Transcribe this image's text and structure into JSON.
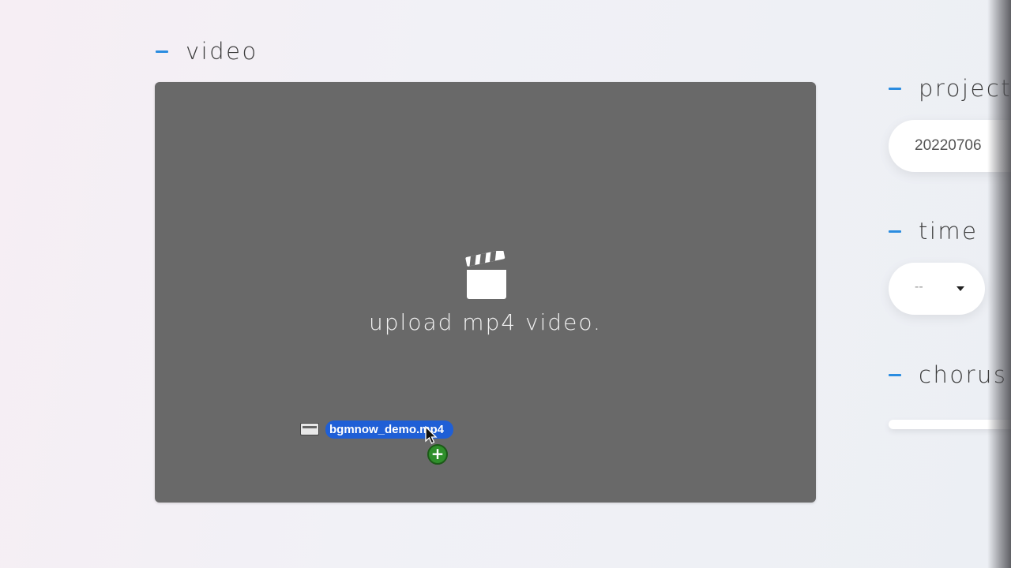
{
  "sections": {
    "video": "video",
    "project": "project",
    "time": "time",
    "chorus": "chorus"
  },
  "dropzone": {
    "text": "upload mp4 video.",
    "icon": "clapperboard-icon"
  },
  "drag": {
    "filename": "bgmnow_demo.mp4",
    "badge": "+"
  },
  "project": {
    "value": "20220706"
  },
  "time": {
    "value": "--"
  },
  "colors": {
    "accent": "#2a8ce0",
    "dropzone_bg": "#696969",
    "drag_pill": "#1f5fd6",
    "add_badge": "#2f8f2b"
  }
}
